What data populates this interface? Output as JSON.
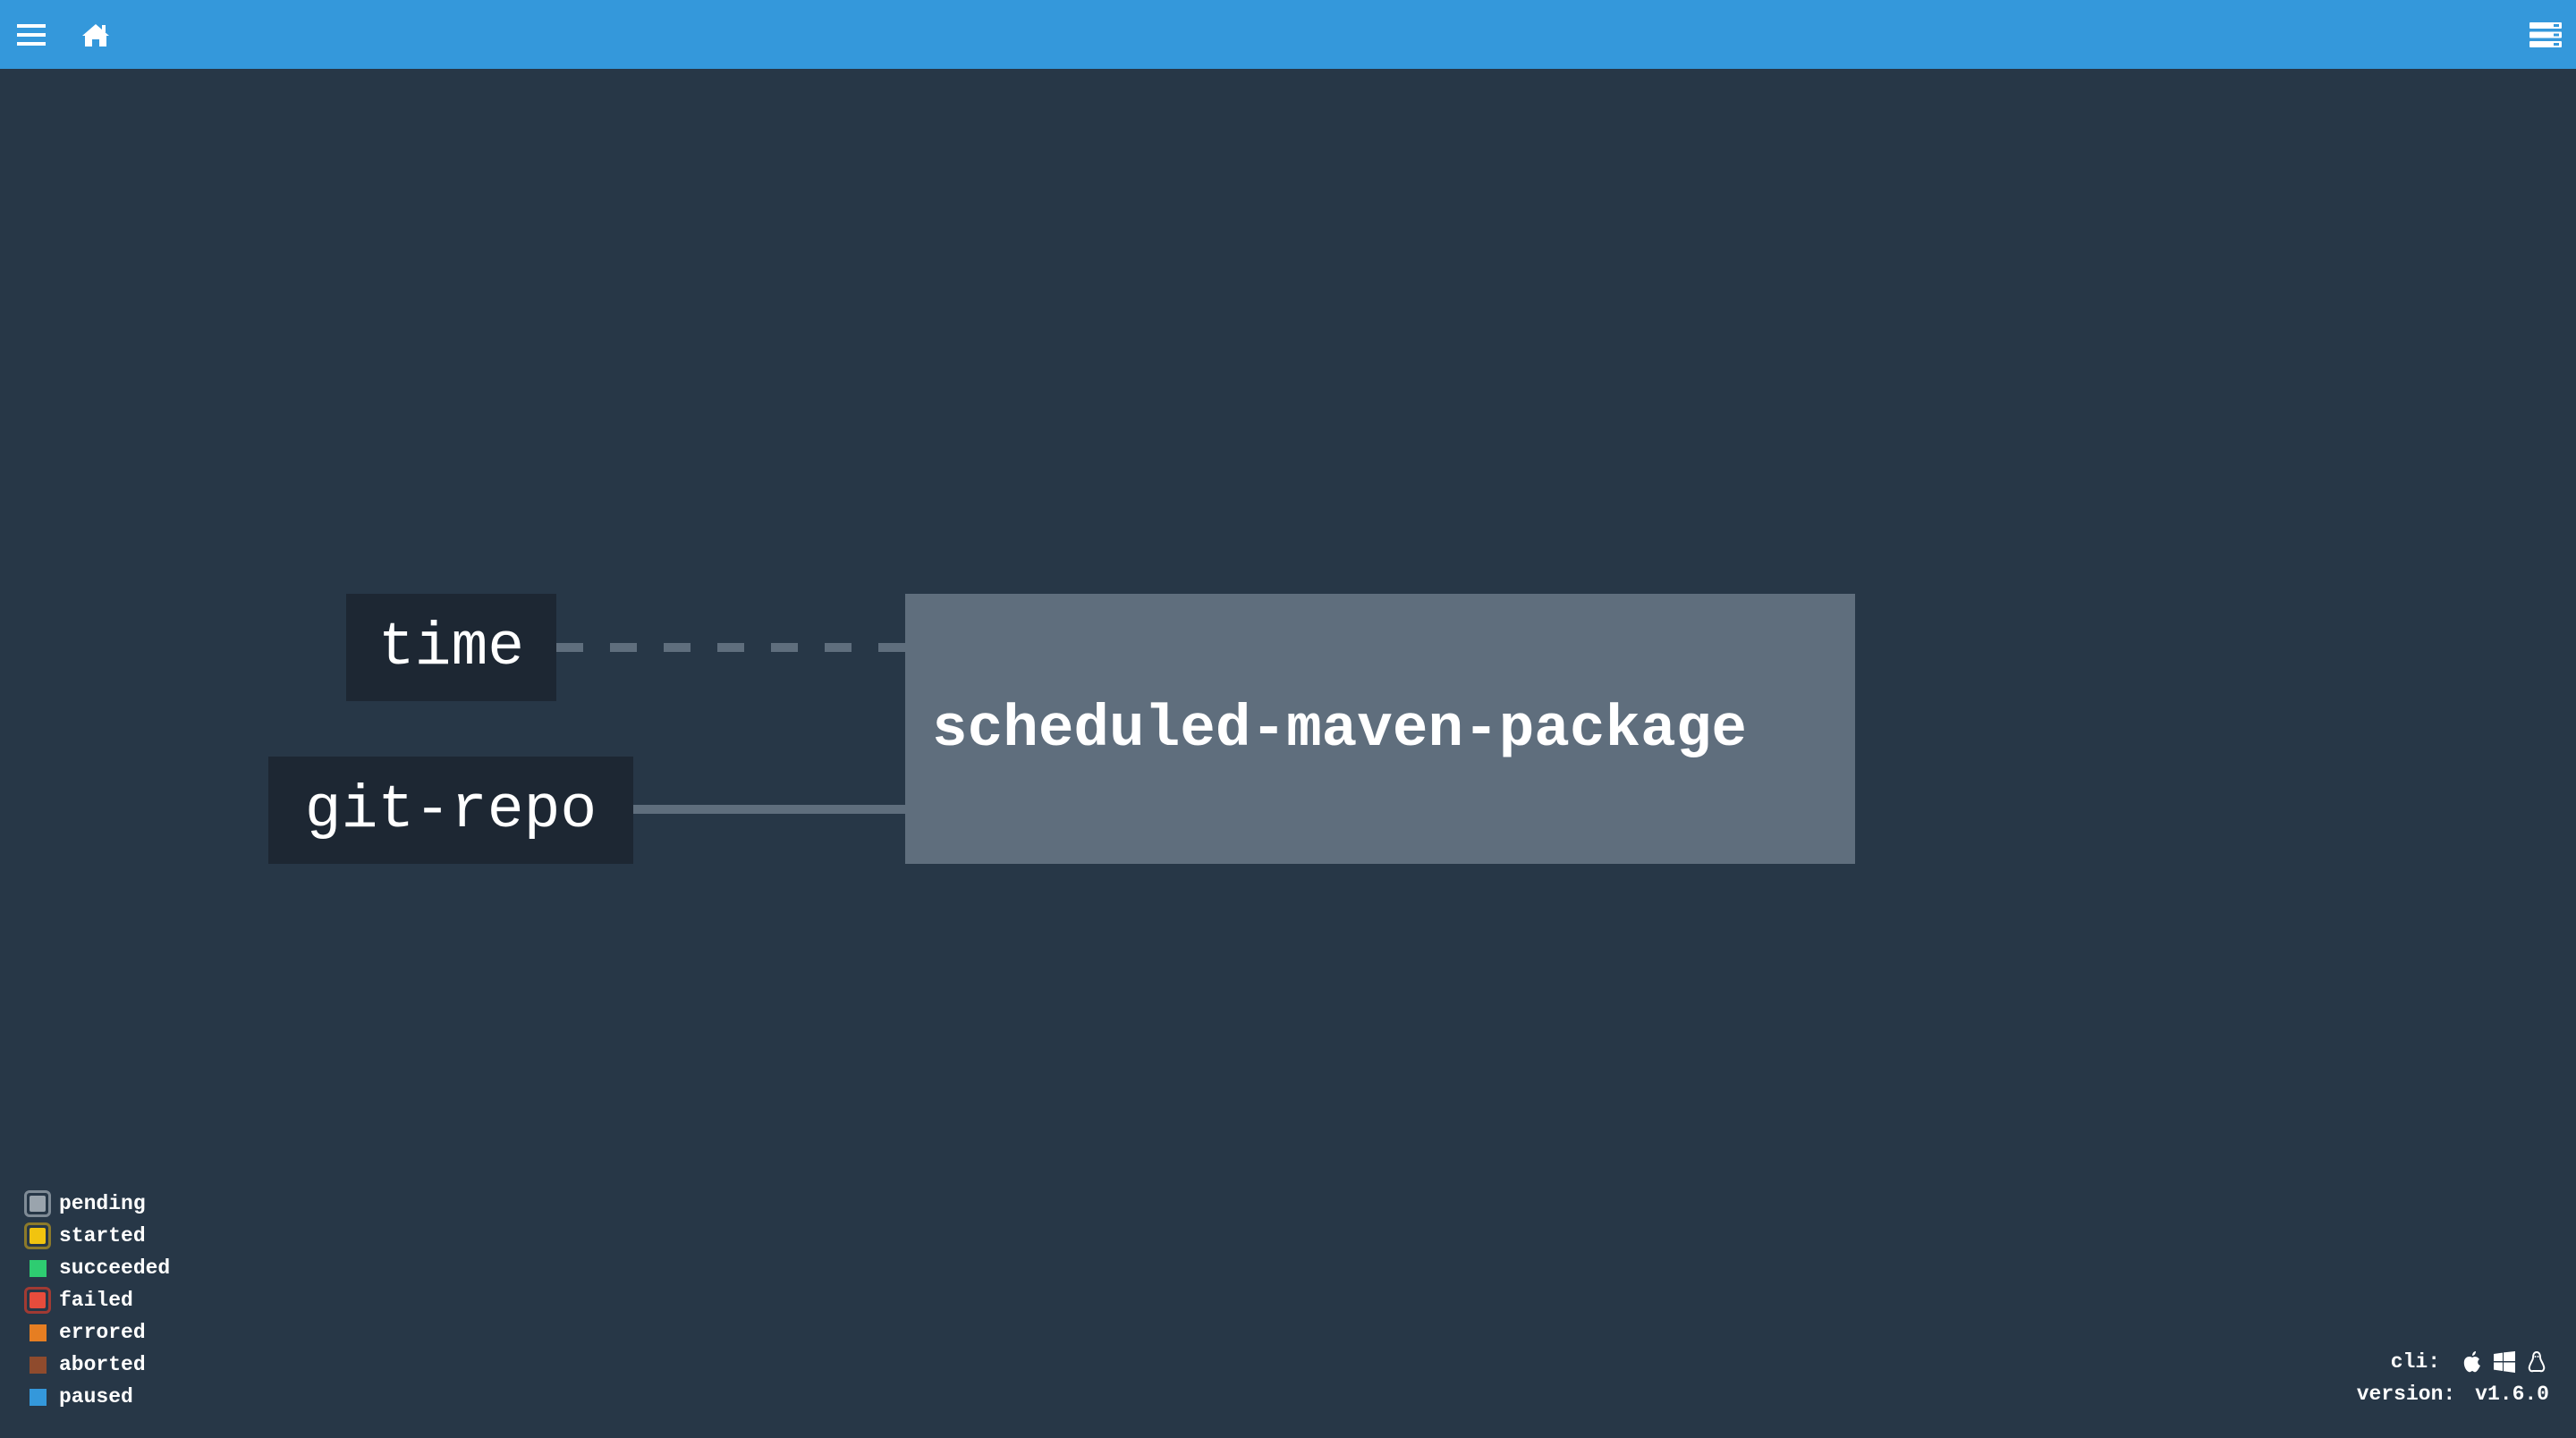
{
  "topbar": {
    "background": "#3498db",
    "menu_icon": "hamburger-menu-icon",
    "home_icon": "home-icon",
    "right_icon": "server-list-icon"
  },
  "pipeline": {
    "resources": [
      {
        "name": "time"
      },
      {
        "name": "git-repo"
      }
    ],
    "job": {
      "name": "scheduled-maven-package",
      "color": "#5f6e7d"
    },
    "edges": [
      {
        "from": "time",
        "to": "scheduled-maven-package",
        "style": "dashed"
      },
      {
        "from": "git-repo",
        "to": "scheduled-maven-package",
        "style": "solid"
      }
    ]
  },
  "legend": [
    {
      "label": "pending",
      "color": "#9aa4ad",
      "ring": true,
      "ring_color": "#7f8b96"
    },
    {
      "label": "started",
      "color": "#f1c40f",
      "ring": true,
      "ring_color": "#8c7a2a"
    },
    {
      "label": "succeeded",
      "color": "#2ecc71",
      "ring": false
    },
    {
      "label": "failed",
      "color": "#e74c3c",
      "ring": true,
      "ring_color": "#a13a33"
    },
    {
      "label": "errored",
      "color": "#e67e22",
      "ring": false
    },
    {
      "label": "aborted",
      "color": "#8f4b2d",
      "ring": false
    },
    {
      "label": "paused",
      "color": "#3498db",
      "ring": false
    }
  ],
  "footer": {
    "cli_label": "cli:",
    "cli_icons": [
      "apple-icon",
      "windows-icon",
      "linux-icon"
    ],
    "version_label": "version:",
    "version_value": "v1.6.0"
  },
  "colors": {
    "background": "#273747",
    "resource_bg": "#1d2733",
    "edge": "#5f6e7d"
  }
}
